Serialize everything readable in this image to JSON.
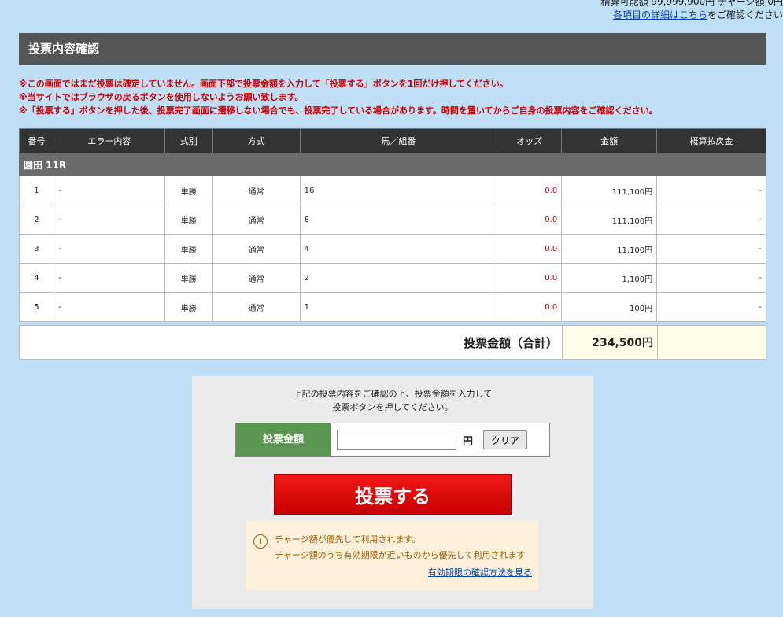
{
  "header": {
    "balance_line": "精算可能額 99,999,900円 チャージ額 0円",
    "detail_link": "各項目の詳細はこちら",
    "detail_suffix": "をご確認ください"
  },
  "title": "投票内容確認",
  "warnings": [
    "※この画面ではまだ投票は確定していません。画面下部で投票金額を入力して「投票する」ボタンを1回だけ押してください。",
    "※当サイトではブラウザの戻るボタンを使用しないようお願い致します。",
    "※「投票する」ボタンを押した後、投票完了画面に遷移しない場合でも、投票完了している場合があります。時間を置いてからご自身の投票内容をご確認ください。"
  ],
  "table": {
    "headers": [
      "番号",
      "エラー内容",
      "式別",
      "方式",
      "馬／組番",
      "オッズ",
      "金額",
      "概算払戻金"
    ],
    "race_label": "園田 11R",
    "rows": [
      {
        "no": "1",
        "error": "-",
        "type": "単勝",
        "method": "通常",
        "horse": "16",
        "odds": "0.0",
        "amount": "111,100円",
        "payout": "-"
      },
      {
        "no": "2",
        "error": "-",
        "type": "単勝",
        "method": "通常",
        "horse": "8",
        "odds": "0.0",
        "amount": "111,100円",
        "payout": "-"
      },
      {
        "no": "3",
        "error": "-",
        "type": "単勝",
        "method": "通常",
        "horse": "4",
        "odds": "0.0",
        "amount": "11,100円",
        "payout": "-"
      },
      {
        "no": "4",
        "error": "-",
        "type": "単勝",
        "method": "通常",
        "horse": "2",
        "odds": "0.0",
        "amount": "1,100円",
        "payout": "-"
      },
      {
        "no": "5",
        "error": "-",
        "type": "単勝",
        "method": "通常",
        "horse": "1",
        "odds": "0.0",
        "amount": "100円",
        "payout": "-"
      }
    ]
  },
  "total": {
    "label": "投票金額（合計）",
    "value": "234,500円"
  },
  "panel": {
    "instruction_l1": "上記の投票内容をご確認の上、投票金額を入力して",
    "instruction_l2": "投票ボタンを押してください。",
    "amount_label": "投票金額",
    "amount_value": "",
    "yen": "円",
    "clear_label": "クリア",
    "vote_label": "投票する",
    "notice_l1": "チャージ額が優先して利用されます。",
    "notice_l2": "チャージ額のうち有効期限が近いものから優先して利用されます",
    "notice_link": "有効期限の確認方法を見る"
  },
  "colors": {
    "background": "#bfdff6",
    "warning": "#cc0000",
    "vote_button": "#e00000",
    "amount_label_bg": "#5a9650"
  },
  "icons": [
    "info-icon"
  ]
}
